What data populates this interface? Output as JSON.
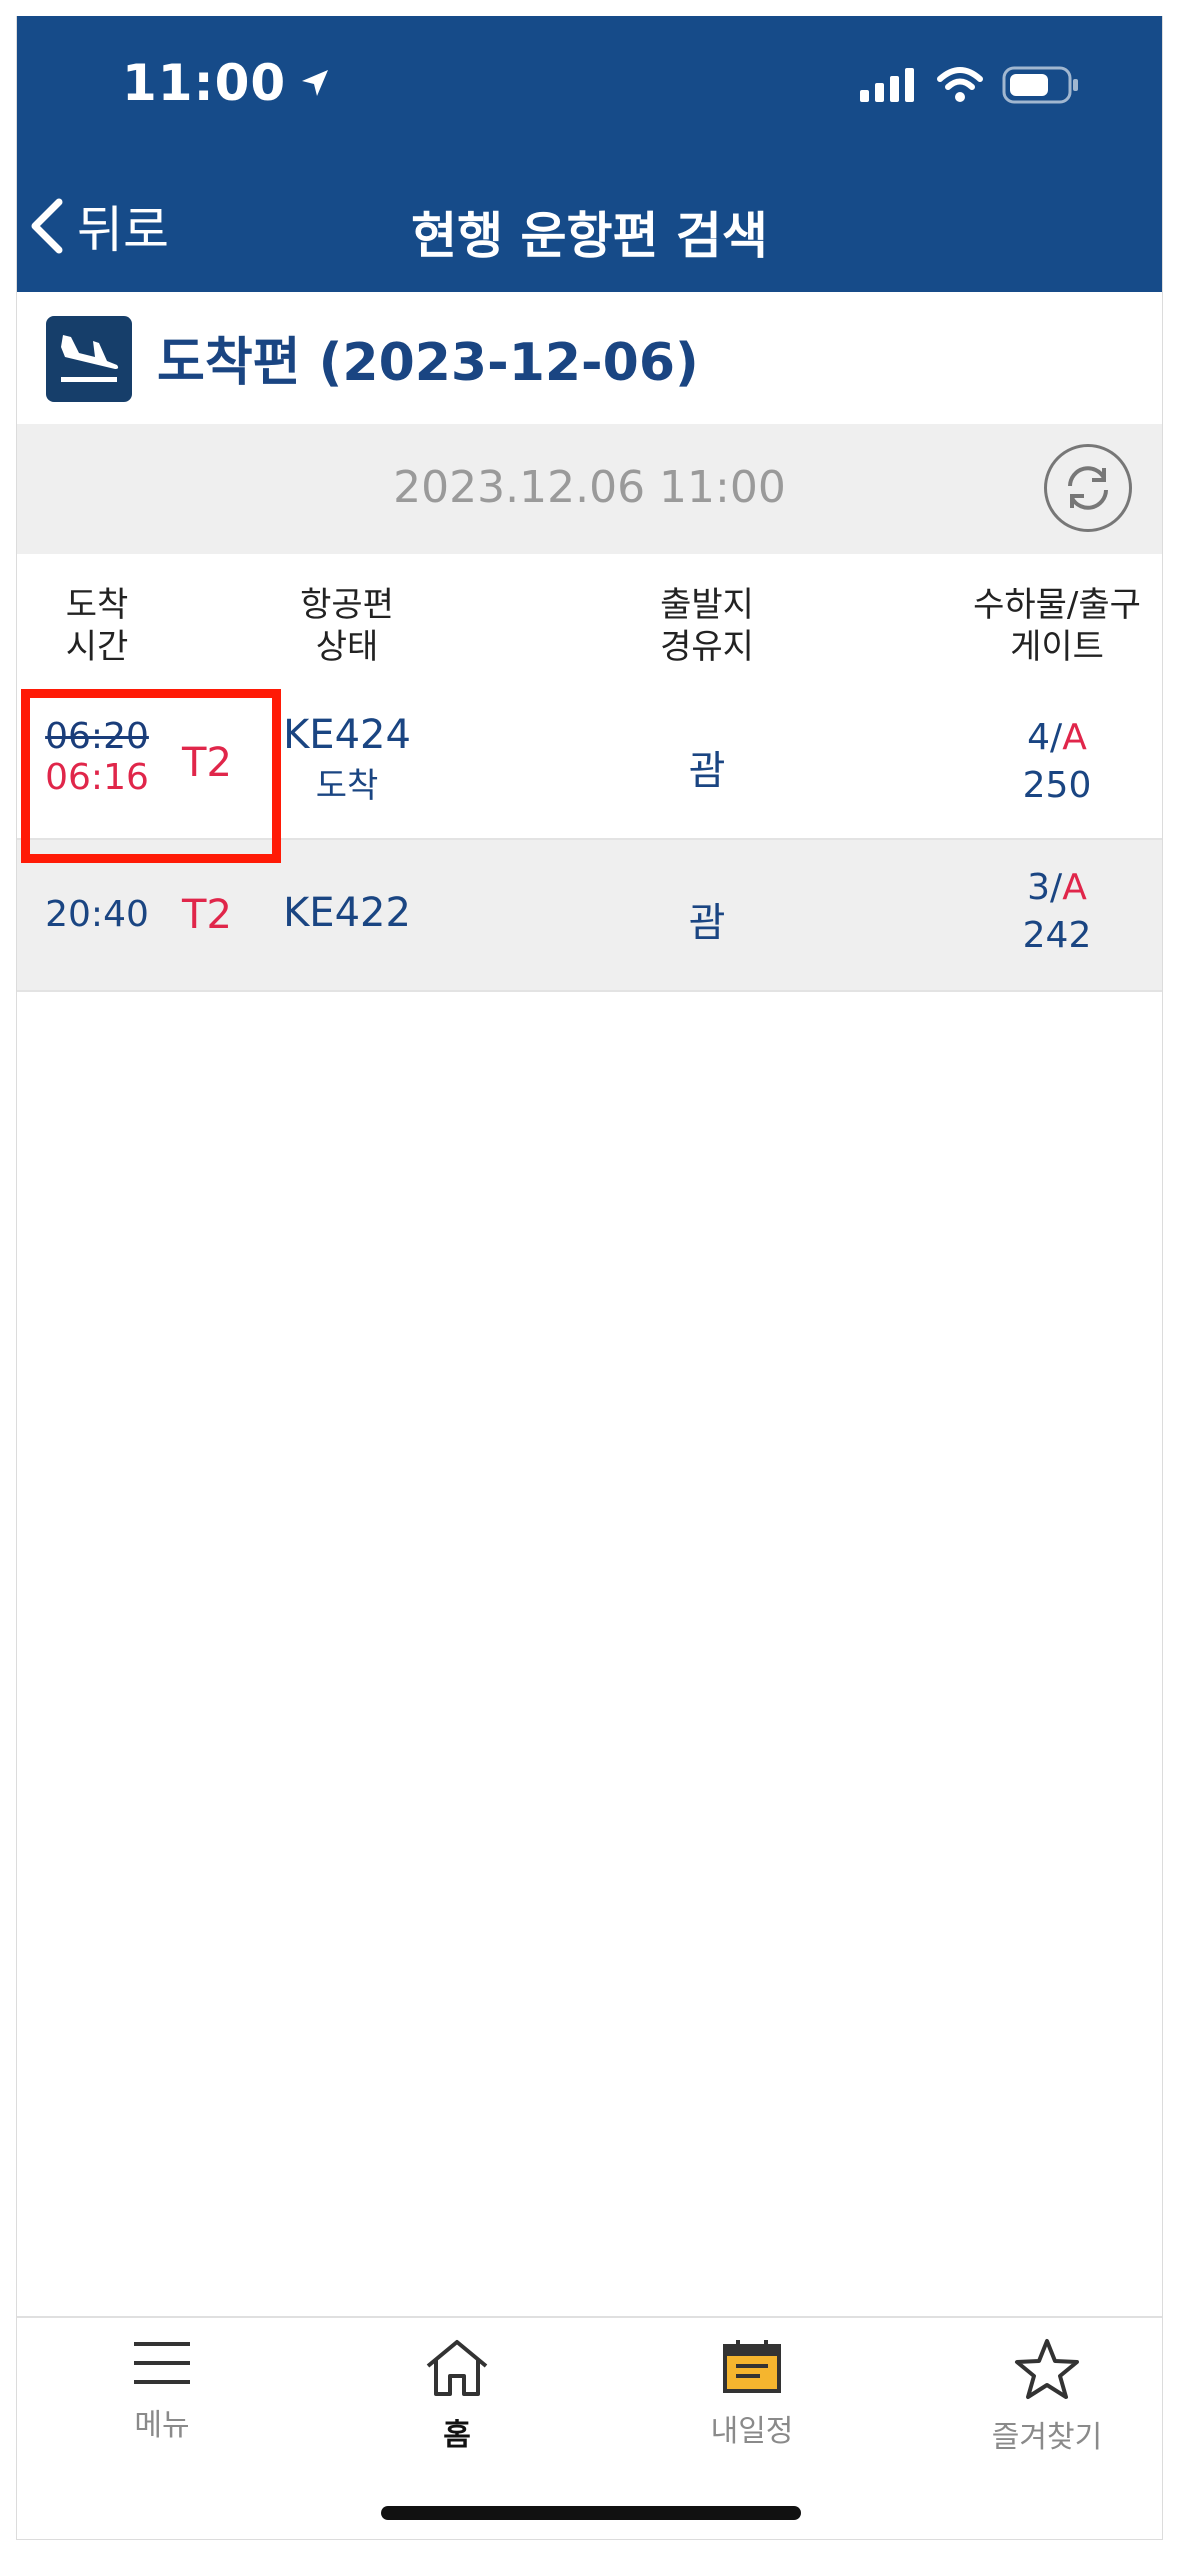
{
  "status_bar": {
    "time": "11:00"
  },
  "header": {
    "back_label": "뒤로",
    "title": "현행 운항편 검색"
  },
  "section": {
    "title": "도착편 (2023-12-06)"
  },
  "timebar": {
    "datetime": "2023.12.06 11:00"
  },
  "columns": [
    {
      "line1": "도착",
      "line2": "시간"
    },
    {
      "line1": "항공편",
      "line2": "상태"
    },
    {
      "line1": "출발지",
      "line2": "경유지"
    },
    {
      "line1": "수하물/출구",
      "line2": "게이트"
    }
  ],
  "flights": [
    {
      "scheduled": "06:20",
      "actual": "06:16",
      "terminal": "T2",
      "flight": "KE424",
      "status": "도착",
      "origin": "괌",
      "baggage": "4/",
      "exit": "A",
      "gate": "250"
    },
    {
      "scheduled": "20:40",
      "terminal": "T2",
      "flight": "KE422",
      "origin": "괌",
      "baggage": "3/",
      "exit": "A",
      "gate": "242"
    }
  ],
  "tabs": [
    {
      "label": "메뉴",
      "icon": "menu-icon"
    },
    {
      "label": "홈",
      "icon": "home-icon",
      "active": true
    },
    {
      "label": "내일정",
      "icon": "calendar-icon"
    },
    {
      "label": "즐겨찾기",
      "icon": "star-icon"
    }
  ],
  "colors": {
    "header": "#164b89",
    "accent_red": "#e0264a",
    "text_blue": "#1a4582",
    "highlight": "#ff1a06"
  }
}
